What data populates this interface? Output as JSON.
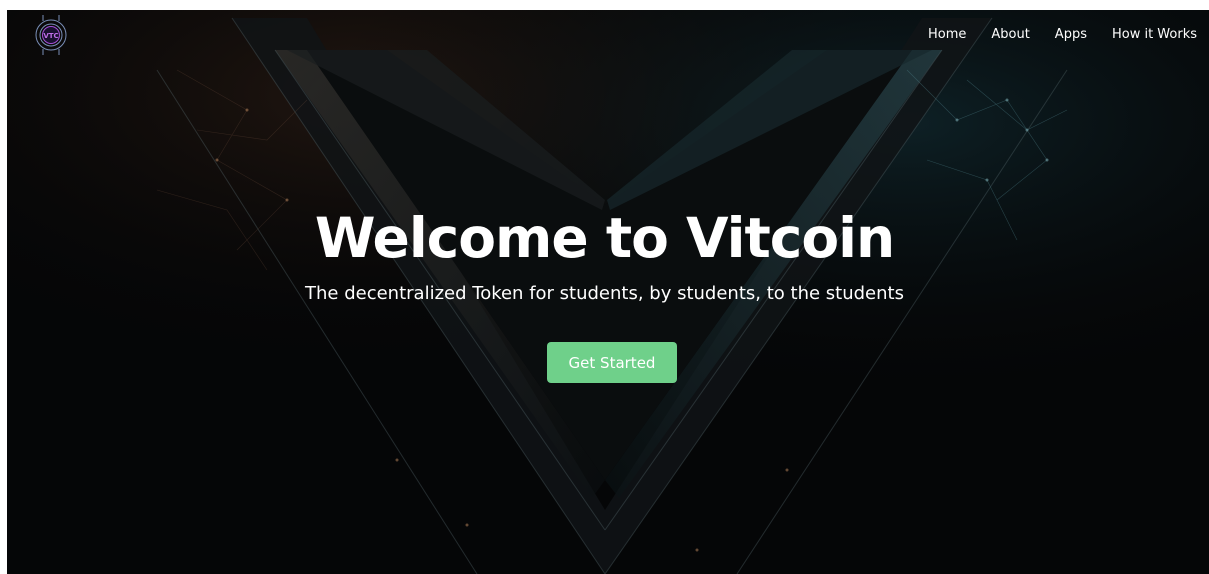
{
  "brand": {
    "logo_text": "VTC",
    "accent_color": "#a24fd6"
  },
  "nav": {
    "items": [
      {
        "label": "Home"
      },
      {
        "label": "About"
      },
      {
        "label": "Apps"
      },
      {
        "label": "How it Works"
      }
    ]
  },
  "hero": {
    "title": "Welcome to Vitcoin",
    "subtitle": "The decentralized Token for students, by students, to the students",
    "cta_label": "Get Started",
    "cta_color": "#6fd08a"
  }
}
